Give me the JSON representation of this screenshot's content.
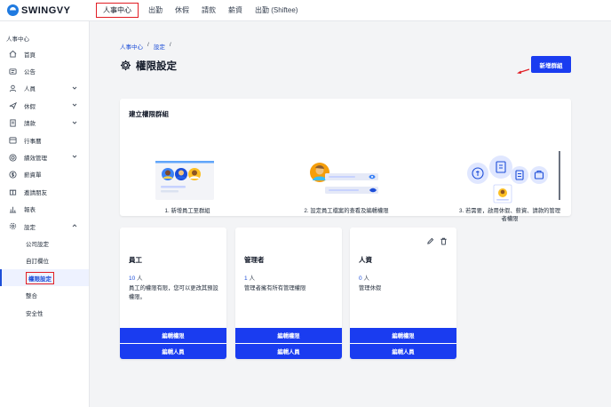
{
  "brand": {
    "name": "SWINGVY"
  },
  "topnav": [
    {
      "label": "人事中心",
      "active": true
    },
    {
      "label": "出勤"
    },
    {
      "label": "休假"
    },
    {
      "label": "請款"
    },
    {
      "label": "薪資"
    },
    {
      "label": "出勤 (Shiftee)"
    }
  ],
  "sidebar": {
    "header": "人事中心",
    "items": [
      {
        "label": "首頁",
        "icon": "home-icon"
      },
      {
        "label": "公告",
        "icon": "megaphone-icon"
      },
      {
        "label": "人員",
        "icon": "user-icon",
        "chevron": "down"
      },
      {
        "label": "休假",
        "icon": "airplane-icon",
        "chevron": "down"
      },
      {
        "label": "請款",
        "icon": "receipt-icon",
        "chevron": "down"
      },
      {
        "label": "行事曆",
        "icon": "calendar-icon"
      },
      {
        "label": "績效管理",
        "icon": "target-icon",
        "chevron": "down"
      },
      {
        "label": "薪資單",
        "icon": "dollar-icon"
      },
      {
        "label": "邀請朋友",
        "icon": "gift-icon"
      },
      {
        "label": "報表",
        "icon": "chart-icon"
      },
      {
        "label": "設定",
        "icon": "gear-icon",
        "chevron": "up"
      }
    ],
    "sub_items": [
      {
        "label": "公司設定"
      },
      {
        "label": "自訂欄位"
      },
      {
        "label": "權限設定",
        "active": true
      },
      {
        "label": "整合"
      },
      {
        "label": "安全性"
      }
    ]
  },
  "breadcrumb": {
    "first": "人事中心",
    "second": "設定",
    "sep": "/"
  },
  "page": {
    "title": "權限設定",
    "add_button": "新增群組"
  },
  "build": {
    "title": "建立權限群組",
    "step1": "1. 新增員工至群組",
    "step2": "2. 設定員工檔案的查看及編輯權限",
    "step3_line1": "3. 若需要，啟用休假、薪資、請款的管理",
    "step3_line2": "者權限"
  },
  "groups": [
    {
      "name": "員工",
      "count": "10",
      "unit": "人",
      "desc": "員工的權限有限，您可以更改其預設權限。",
      "edit_perm": "編輯權限",
      "edit_members": "編輯人員"
    },
    {
      "name": "管理者",
      "count": "1",
      "unit": "人",
      "desc": "管理者擁有所有管理權限",
      "edit_perm": "編輯權限",
      "edit_members": "編輯人員"
    },
    {
      "name": "人資",
      "count": "0",
      "unit": "人",
      "desc": "管理休假",
      "edit_perm": "編輯權限",
      "edit_members": "編輯人員",
      "tools": [
        "pencil-icon",
        "trash-icon"
      ]
    }
  ],
  "colors": {
    "primary": "#1a3cf0",
    "link": "#1d4ed8",
    "highlight": "#e11d24"
  }
}
